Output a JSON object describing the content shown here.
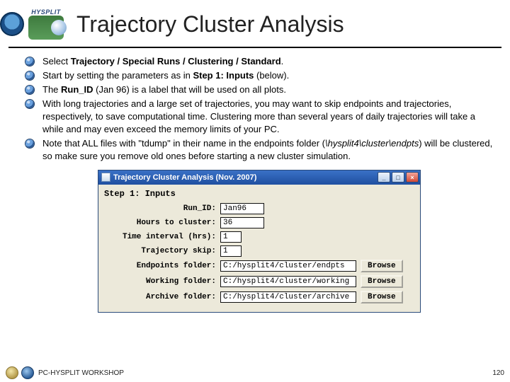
{
  "header": {
    "product_label": "HYSPLIT",
    "title": "Trajectory Cluster Analysis"
  },
  "bullets": [
    {
      "segments": [
        {
          "t": "Select ",
          "b": false
        },
        {
          "t": "Trajectory / Special Runs / Clustering / Standard",
          "b": true
        },
        {
          "t": ".",
          "b": false
        }
      ]
    },
    {
      "segments": [
        {
          "t": "Start by setting the parameters as in ",
          "b": false
        },
        {
          "t": "Step 1: Inputs",
          "b": true
        },
        {
          "t": " (below).",
          "b": false
        }
      ]
    },
    {
      "segments": [
        {
          "t": "The ",
          "b": false
        },
        {
          "t": "Run_ID",
          "b": true
        },
        {
          "t": " (Jan 96) is a label that will be used on all plots.",
          "b": false
        }
      ]
    },
    {
      "segments": [
        {
          "t": "With long trajectories and a large set of trajectories, you may want to skip endpoints and trajectories, respectively, to save computational time. Clustering more than several years of daily trajectories will take a while and may even exceed the memory limits of your PC.",
          "b": false
        }
      ]
    },
    {
      "segments": [
        {
          "t": "Note that ALL files with \"tdump\" in their name in the endpoints folder (",
          "b": false
        },
        {
          "t": "\\hysplit4\\cluster\\endpts",
          "i": true
        },
        {
          "t": ") will be clustered, so make sure you remove old ones before starting a new cluster simulation.",
          "b": false
        }
      ]
    }
  ],
  "dialog": {
    "title": "Trajectory Cluster Analysis (Nov. 2007)",
    "step_label": "Step 1: Inputs",
    "browse_label": "Browse",
    "fields": {
      "run_id": {
        "label": "Run_ID:",
        "value": "Jan96"
      },
      "hours": {
        "label": "Hours to cluster:",
        "value": "36"
      },
      "interval": {
        "label": "Time interval (hrs):",
        "value": "1"
      },
      "skip": {
        "label": "Trajectory skip:",
        "value": "1"
      },
      "endpts": {
        "label": "Endpoints folder:",
        "value": "C:/hysplit4/cluster/endpts"
      },
      "working": {
        "label": "Working folder:",
        "value": "C:/hysplit4/cluster/working"
      },
      "archive": {
        "label": "Archive folder:",
        "value": "C:/hysplit4/cluster/archive"
      }
    }
  },
  "footer": {
    "workshop": "PC-HYSPLIT WORKSHOP",
    "page": "120"
  }
}
